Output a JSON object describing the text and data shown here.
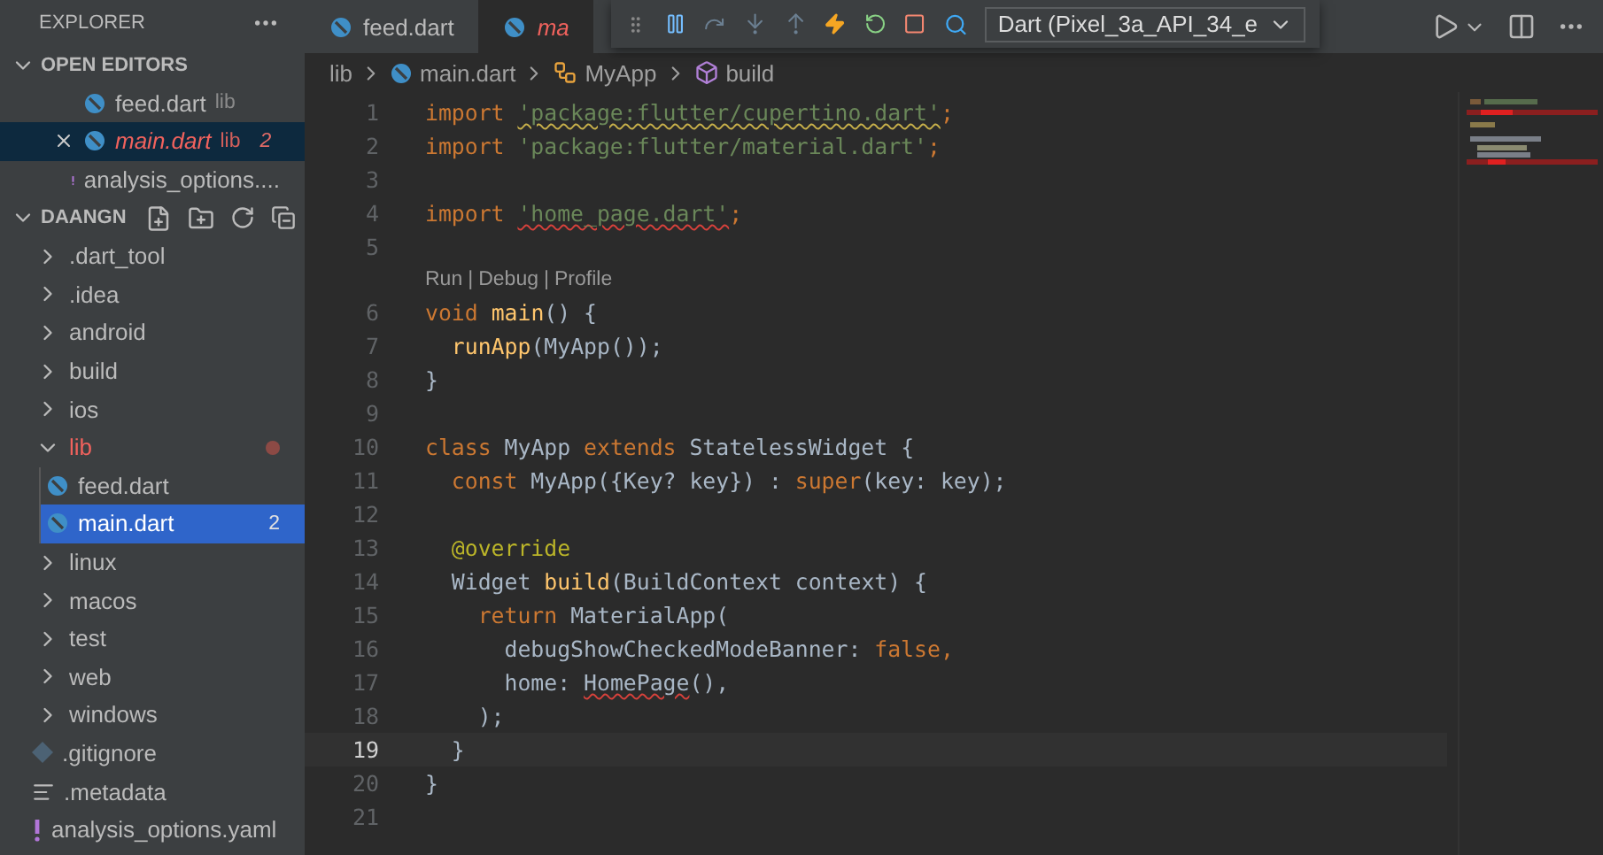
{
  "explorer": {
    "title": "EXPLORER"
  },
  "open_editors": {
    "title": "OPEN EDITORS",
    "expanded": true,
    "items": [
      {
        "name": "feed.dart",
        "folder": "lib",
        "kind": "dart",
        "selected": false,
        "error": false
      },
      {
        "name": "main.dart",
        "folder": "lib",
        "kind": "dart",
        "selected": true,
        "error": true,
        "badge": "2"
      },
      {
        "name": "analysis_options....",
        "kind": "warning",
        "selected": false,
        "error": false
      }
    ]
  },
  "project": {
    "title": "DAANGN",
    "expanded": true,
    "items": [
      {
        "name": ".dart_tool",
        "kind": "folder",
        "expanded": false,
        "selected": false,
        "error": false,
        "dot": false
      },
      {
        "name": ".idea",
        "kind": "folder",
        "expanded": false,
        "selected": false,
        "error": false,
        "dot": false
      },
      {
        "name": "android",
        "kind": "folder",
        "expanded": false,
        "selected": false,
        "error": false,
        "dot": false
      },
      {
        "name": "build",
        "kind": "folder",
        "expanded": false,
        "selected": false,
        "error": false,
        "dot": false
      },
      {
        "name": "ios",
        "kind": "folder",
        "expanded": false,
        "selected": false,
        "error": false,
        "dot": false
      },
      {
        "name": "lib",
        "kind": "folder",
        "expanded": true,
        "selected": false,
        "error": true,
        "dot": true,
        "children": [
          {
            "name": "feed.dart",
            "kind": "dart",
            "selected": false
          },
          {
            "name": "main.dart",
            "kind": "dart",
            "selected": true,
            "badge": "2"
          }
        ]
      },
      {
        "name": "linux",
        "kind": "folder",
        "expanded": false,
        "selected": false,
        "error": false,
        "dot": false
      },
      {
        "name": "macos",
        "kind": "folder",
        "expanded": false,
        "selected": false,
        "error": false,
        "dot": false
      },
      {
        "name": "test",
        "kind": "folder",
        "expanded": false,
        "selected": false,
        "error": false,
        "dot": false
      },
      {
        "name": "web",
        "kind": "folder",
        "expanded": false,
        "selected": false,
        "error": false,
        "dot": false
      },
      {
        "name": "windows",
        "kind": "folder",
        "expanded": false,
        "selected": false,
        "error": false,
        "dot": false
      },
      {
        "name": ".gitignore",
        "kind": "git",
        "selected": false,
        "error": false,
        "dot": false
      },
      {
        "name": ".metadata",
        "kind": "lines",
        "selected": false,
        "error": false,
        "dot": false
      },
      {
        "name": "analysis_options.yaml",
        "kind": "warning",
        "selected": false,
        "error": false,
        "dot": false
      }
    ]
  },
  "tabs": [
    {
      "label": "feed.dart",
      "selected": false,
      "error": false
    },
    {
      "label": "ma",
      "selected": true,
      "error": true
    }
  ],
  "debug_toolbar": {
    "device": "Dart (Pixel_3a_API_34_e"
  },
  "breadcrumb": [
    {
      "label": "lib",
      "kind": "folder"
    },
    {
      "label": "main.dart",
      "kind": "dart"
    },
    {
      "label": "MyApp",
      "kind": "class"
    },
    {
      "label": "build",
      "kind": "method"
    }
  ],
  "code": [
    {
      "number": "1",
      "current": false,
      "tokens": [
        {
          "text": "import ",
          "kind": "kw"
        },
        {
          "text": "'package:flutter/cupertino.dart'",
          "kind": "str",
          "warning": true
        },
        {
          "text": ";",
          "kind": "kw"
        }
      ]
    },
    {
      "number": "2",
      "current": false,
      "tokens": [
        {
          "text": "import ",
          "kind": "kw"
        },
        {
          "text": "'package:flutter/material.dart'",
          "kind": "str"
        },
        {
          "text": ";",
          "kind": "kw"
        }
      ]
    },
    {
      "number": "3",
      "current": false
    },
    {
      "number": "4",
      "current": false,
      "tokens": [
        {
          "text": "import ",
          "kind": "kw"
        },
        {
          "text": "'home_page.dart'",
          "kind": "str",
          "error": true
        },
        {
          "text": ";",
          "kind": "kw"
        }
      ]
    },
    {
      "number": "5",
      "current": false
    },
    {
      "kind": "codelens",
      "links": [
        "Run",
        "Debug",
        "Profile"
      ],
      "separator": "|"
    },
    {
      "number": "6",
      "current": false,
      "tokens": [
        {
          "text": "void ",
          "kind": "kw"
        },
        {
          "text": "main",
          "kind": "fn"
        },
        {
          "text": "() {",
          "kind": "plain"
        }
      ]
    },
    {
      "number": "7",
      "current": false,
      "tokens": [
        {
          "text": "  runApp",
          "kind": "fn"
        },
        {
          "text": "(MyApp());",
          "kind": "plain"
        }
      ]
    },
    {
      "number": "8",
      "current": false,
      "tokens": [
        {
          "text": "}",
          "kind": "plain"
        }
      ]
    },
    {
      "number": "9",
      "current": false
    },
    {
      "number": "10",
      "current": false,
      "tokens": [
        {
          "text": "class",
          "kind": "kw"
        },
        {
          "text": " MyApp ",
          "kind": "plain"
        },
        {
          "text": "extends",
          "kind": "kw"
        },
        {
          "text": " StatelessWidget {",
          "kind": "plain"
        }
      ]
    },
    {
      "number": "11",
      "current": false,
      "tokens": [
        {
          "text": "  const",
          "kind": "kw"
        },
        {
          "text": " MyApp({Key? key}) : ",
          "kind": "plain"
        },
        {
          "text": "super",
          "kind": "kw"
        },
        {
          "text": "(key: key);",
          "kind": "plain"
        }
      ]
    },
    {
      "number": "12",
      "current": false
    },
    {
      "number": "13",
      "current": false,
      "tokens": [
        {
          "text": "  @override",
          "kind": "ann"
        }
      ]
    },
    {
      "number": "14",
      "current": false,
      "tokens": [
        {
          "text": "  Widget ",
          "kind": "plain"
        },
        {
          "text": "build",
          "kind": "fn"
        },
        {
          "text": "(BuildContext context) {",
          "kind": "plain"
        }
      ]
    },
    {
      "number": "15",
      "current": false,
      "tokens": [
        {
          "text": "    return",
          "kind": "kw"
        },
        {
          "text": " MaterialApp(",
          "kind": "plain"
        }
      ]
    },
    {
      "number": "16",
      "current": false,
      "tokens": [
        {
          "text": "      debugShowCheckedModeBanner: ",
          "kind": "plain"
        },
        {
          "text": "false",
          "kind": "kw"
        },
        {
          "text": ",",
          "kind": "kw"
        }
      ]
    },
    {
      "number": "17",
      "current": false,
      "tokens": [
        {
          "text": "      home: ",
          "kind": "plain"
        },
        {
          "text": "HomePage",
          "kind": "plain",
          "error": true
        },
        {
          "text": "(),",
          "kind": "plain"
        }
      ]
    },
    {
      "number": "18",
      "current": false,
      "tokens": [
        {
          "text": "    );",
          "kind": "plain"
        }
      ]
    },
    {
      "number": "19",
      "current": true,
      "tokens": [
        {
          "text": "  }",
          "kind": "plain"
        }
      ]
    },
    {
      "number": "20",
      "current": false,
      "tokens": [
        {
          "text": "}",
          "kind": "plain"
        }
      ]
    },
    {
      "number": "21",
      "current": false
    }
  ]
}
